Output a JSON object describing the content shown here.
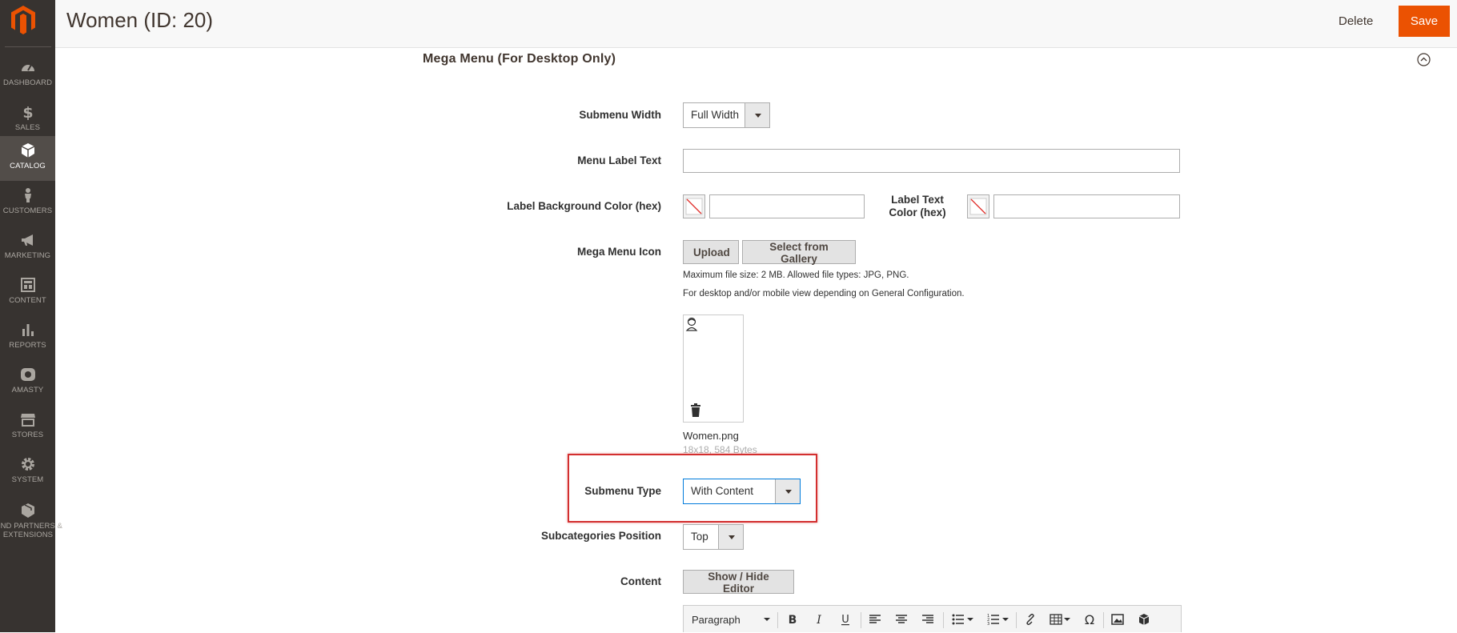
{
  "sidebar": {
    "items": [
      {
        "label": "DASHBOARD",
        "icon": "dashboard-icon"
      },
      {
        "label": "SALES",
        "icon": "dollar-icon"
      },
      {
        "label": "CATALOG",
        "icon": "box-icon",
        "active": true
      },
      {
        "label": "CUSTOMERS",
        "icon": "person-icon"
      },
      {
        "label": "MARKETING",
        "icon": "megaphone-icon"
      },
      {
        "label": "CONTENT",
        "icon": "layout-icon"
      },
      {
        "label": "REPORTS",
        "icon": "bar-chart-icon"
      },
      {
        "label": "AMASTY",
        "icon": "amasty-icon"
      },
      {
        "label": "STORES",
        "icon": "store-icon"
      },
      {
        "label": "SYSTEM",
        "icon": "gear-icon"
      },
      {
        "label": "FIND PARTNERS & EXTENSIONS",
        "icon": "extensions-icon"
      }
    ]
  },
  "header": {
    "title": "Women (ID: 20)",
    "delete_label": "Delete",
    "save_label": "Save"
  },
  "section": {
    "title": "Mega Menu (For Desktop Only)"
  },
  "form": {
    "submenu_width": {
      "label": "Submenu Width",
      "value": "Full Width"
    },
    "menu_label_text": {
      "label": "Menu Label Text",
      "value": ""
    },
    "label_bg_color": {
      "label": "Label Background Color (hex)",
      "value": ""
    },
    "label_text_color": {
      "label_line1": "Label Text",
      "label_line2": "Color (hex)",
      "value": ""
    },
    "mega_menu_icon": {
      "label": "Mega Menu Icon",
      "upload_label": "Upload",
      "gallery_label": "Select from Gallery",
      "note1": "Maximum file size: 2 MB. Allowed file types: JPG, PNG.",
      "note2": "For desktop and/or mobile view depending on General Configuration.",
      "file_name": "Women.png",
      "file_meta": "18x18, 584 Bytes"
    },
    "submenu_type": {
      "label": "Submenu Type",
      "value": "With Content"
    },
    "subcategories_position": {
      "label": "Subcategories Position",
      "value": "Top"
    },
    "content": {
      "label": "Content",
      "toggle_label": "Show / Hide Editor"
    }
  },
  "editor": {
    "format_value": "Paragraph"
  },
  "colors": {
    "sidebar_bg": "#373330",
    "accent": "#eb5202",
    "highlight": "#d32f2f"
  }
}
